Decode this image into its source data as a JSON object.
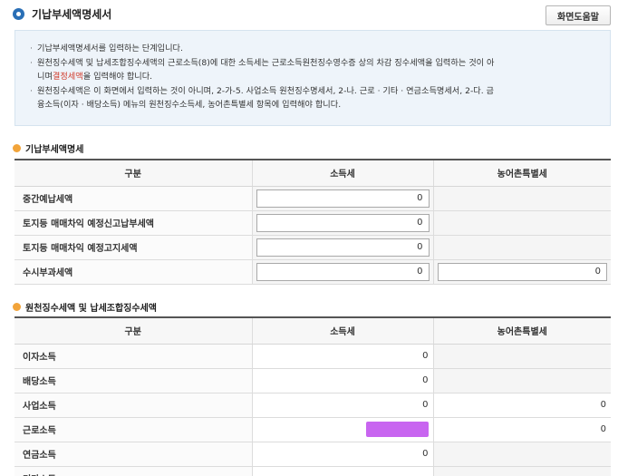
{
  "page": {
    "title": "기납부세액명세서",
    "help_button": "화면도움말"
  },
  "info": {
    "line1": "기납부세액명세서를 입력하는 단계입니다.",
    "line2a": "원천징수세액 및 납세조합징수세액의 근로소득(8)에 대한 소득세는 근로소득원천징수영수증 상의 차감 징수세액을 입력하는 것이 아",
    "line2b": "니며",
    "line2red": "결정세액",
    "line2c": "을 입력해야 합니다.",
    "line3a": "원천징수세액은 이 화면에서 입력하는 것이 아니며, 2-가-5. 사업소득 원천징수명세서, 2-나. 근로 · 기타 · 연금소득명세서, 2-다. 금",
    "line3b": "융소득(이자 · 배당소득) 메뉴의 원천징수소득세, 농어촌특별세 항목에 입력해야 합니다."
  },
  "section1": {
    "title": "기납부세액명세",
    "headers": [
      "구분",
      "소득세",
      "농어촌특별세"
    ],
    "rows": [
      {
        "label": "중간예납세액",
        "income_tax": "0",
        "rural_tax": ""
      },
      {
        "label": "토지등 매매차익 예정신고납부세액",
        "income_tax": "0",
        "rural_tax": ""
      },
      {
        "label": "토지등 매매차익 예정고지세액",
        "income_tax": "0",
        "rural_tax": ""
      },
      {
        "label": "수시부과세액",
        "income_tax": "0",
        "rural_tax": "0"
      }
    ]
  },
  "section2": {
    "title": "원천징수세액 및 납세조합징수세액",
    "headers": [
      "구분",
      "소득세",
      "농어촌특별세"
    ],
    "rows": [
      {
        "label": "이자소득",
        "income_tax": "0",
        "rural_tax": ""
      },
      {
        "label": "배당소득",
        "income_tax": "0",
        "rural_tax": ""
      },
      {
        "label": "사업소득",
        "income_tax": "0",
        "rural_tax": "0"
      },
      {
        "label": "근로소득",
        "income_tax": "",
        "rural_tax": "0"
      },
      {
        "label": "연금소득",
        "income_tax": "0",
        "rural_tax": ""
      },
      {
        "label": "기타소득",
        "income_tax": "",
        "rural_tax": ""
      }
    ]
  },
  "colors": {
    "title_icon": "#2a6fb6",
    "section_bullet": "#f2a43a",
    "info_bg": "#eef4fa",
    "redacted": "#c865f0",
    "emphasis": "#d03a2a"
  }
}
